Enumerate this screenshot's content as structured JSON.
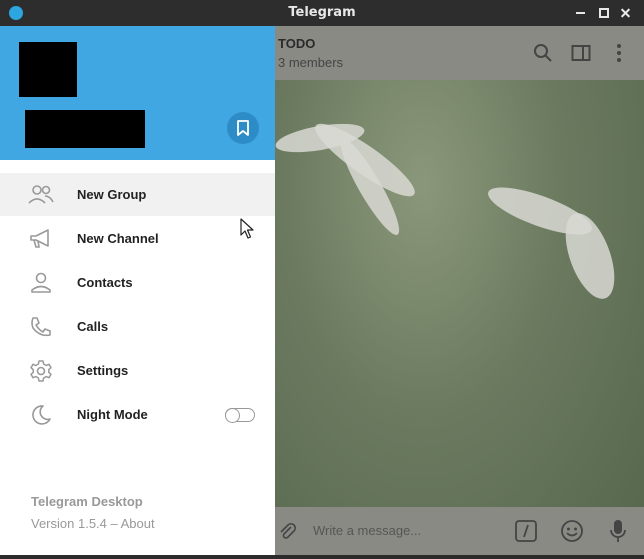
{
  "window": {
    "title": "Telegram"
  },
  "chat": {
    "title": "TODO",
    "subtitle": "3 members",
    "composer_placeholder": "Write a message..."
  },
  "menu": {
    "items": [
      {
        "label": "New Group",
        "icon": "group-icon"
      },
      {
        "label": "New Channel",
        "icon": "megaphone-icon"
      },
      {
        "label": "Contacts",
        "icon": "person-icon"
      },
      {
        "label": "Calls",
        "icon": "phone-icon"
      },
      {
        "label": "Settings",
        "icon": "gear-icon"
      },
      {
        "label": "Night Mode",
        "icon": "moon-icon"
      }
    ],
    "night_mode_enabled": false
  },
  "footer": {
    "app_name": "Telegram Desktop",
    "version": "Version 1.5.4 – About"
  },
  "colors": {
    "header_blue": "#40a7e3",
    "icon_gray": "#999999"
  }
}
